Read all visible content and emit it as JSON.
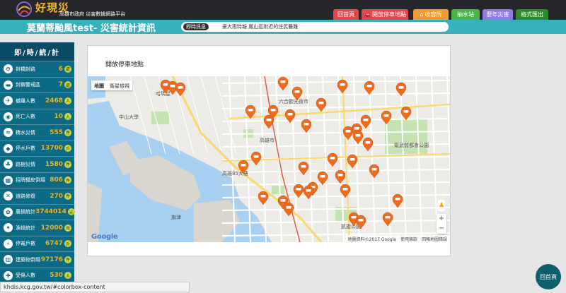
{
  "header": {
    "logo_title": "好現災",
    "logo_subtitle": "高雄市政府 災害數據網路平台",
    "nav": [
      {
        "label": "回首頁",
        "icon": "",
        "color": "#e1474f"
      },
      {
        "label": "開放停車地點",
        "icon": "car-icon",
        "color": "#e1474f"
      },
      {
        "label": "收容所",
        "icon": "house-icon",
        "color": "#f29a32"
      },
      {
        "label": "抽水站",
        "icon": "",
        "color": "#49b549"
      },
      {
        "label": "歷年災害",
        "icon": "",
        "color": "#8e7ce0"
      },
      {
        "label": "格式匯出",
        "icon": "",
        "color": "#2b8a2b"
      }
    ]
  },
  "title_bar": {
    "title": "莫蘭蒂颱風test- 災害統計資訊",
    "ticker_label": "即時訊息",
    "ticker_text": "豪大雨特報 鳳山區附近的住民醫難"
  },
  "sidebar": {
    "heading": "即/時/統/計",
    "stats": [
      {
        "label": "封橋封路",
        "value": "6",
        "unit": "處",
        "icon": "road-icon"
      },
      {
        "label": "封鎖警戒區",
        "value": "7",
        "unit": "處",
        "icon": "barrier-icon"
      },
      {
        "label": "撤離人數",
        "value": "2468",
        "unit": "人",
        "icon": "evacuate-icon"
      },
      {
        "label": "死亡人數",
        "value": "10",
        "unit": "人",
        "icon": "camera-icon"
      },
      {
        "label": "積水災情",
        "value": "555",
        "unit": "件",
        "icon": "flood-icon"
      },
      {
        "label": "停水戶數",
        "value": "13700",
        "unit": "戶",
        "icon": "water-icon"
      },
      {
        "label": "路樹災情",
        "value": "1580",
        "unit": "件",
        "icon": "tree-icon"
      },
      {
        "label": "招牌鐵皮倒塌",
        "value": "806",
        "unit": "件",
        "icon": "sign-icon"
      },
      {
        "label": "道路修復",
        "value": "270",
        "unit": "件",
        "icon": "repair-icon"
      },
      {
        "label": "農損統計",
        "value": "3744014",
        "unit": "元",
        "icon": "farm-icon"
      },
      {
        "label": "漁損統計",
        "value": "12000",
        "unit": "元",
        "icon": "fish-icon"
      },
      {
        "label": "停電戶數",
        "value": "6747",
        "unit": "戶",
        "icon": "power-icon"
      },
      {
        "label": "建築物倒塌",
        "value": "97176",
        "unit": "件",
        "icon": "building-icon"
      },
      {
        "label": "受傷人數",
        "value": "530",
        "unit": "人",
        "icon": "injury-icon"
      }
    ]
  },
  "main": {
    "card_title": "開放停車地點",
    "map": {
      "type_options": [
        "地圖",
        "衛星檢視"
      ],
      "place_labels": [
        "高雄85大樓",
        "凱旋公園",
        "衛武營都會公園",
        "高雄市",
        "六合觀光夜市",
        "中山大學",
        "哈瑪星",
        "旗津"
      ],
      "footer_items": [
        "地圖資料©2017 Google",
        "使用條款",
        "回報地圖錯誤"
      ],
      "google_logo": "Google",
      "zoom_in": "+",
      "zoom_out": "−",
      "marker_icon": "car-marker-icon",
      "marker_color": "#ef6c1f"
    }
  },
  "status_url": "khdis.kcg.gov.tw/#colorbox-content",
  "home_button": "回首頁"
}
